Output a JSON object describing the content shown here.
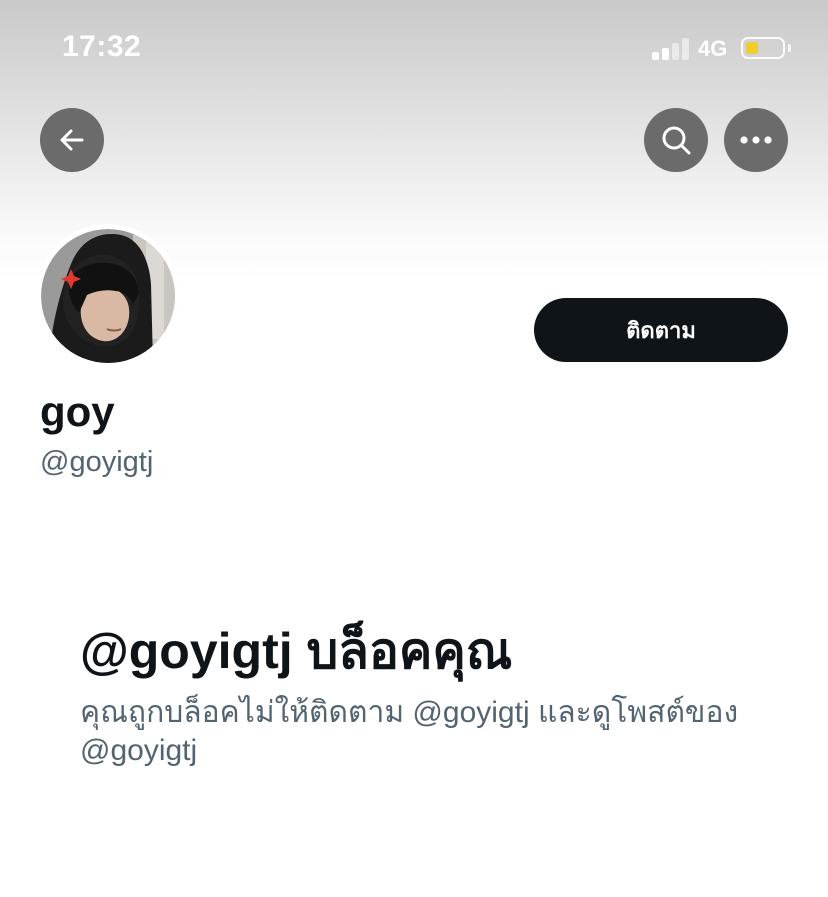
{
  "status_bar": {
    "time": "17:32",
    "network": "4G",
    "battery_color": "#f2cc2e"
  },
  "header": {
    "back_icon": "arrow-left-icon",
    "search_icon": "search-icon",
    "more_icon": "more-horizontal-icon"
  },
  "profile": {
    "display_name": "goy",
    "handle": "@goyigtj",
    "follow_label": "ติดตาม",
    "avatar_icon": "avatar-photo"
  },
  "blocked": {
    "title": "@goyigtj บล็อคคุณ",
    "description": "คุณถูกบล็อคไม่ให้ติดตาม @goyigtj และดูโพสต์ของ @goyigtj"
  },
  "colors": {
    "primary_text": "#0f1419",
    "secondary_text": "#536471",
    "button_bg": "#0f1419",
    "header_button_bg": "#6b6b6b"
  }
}
